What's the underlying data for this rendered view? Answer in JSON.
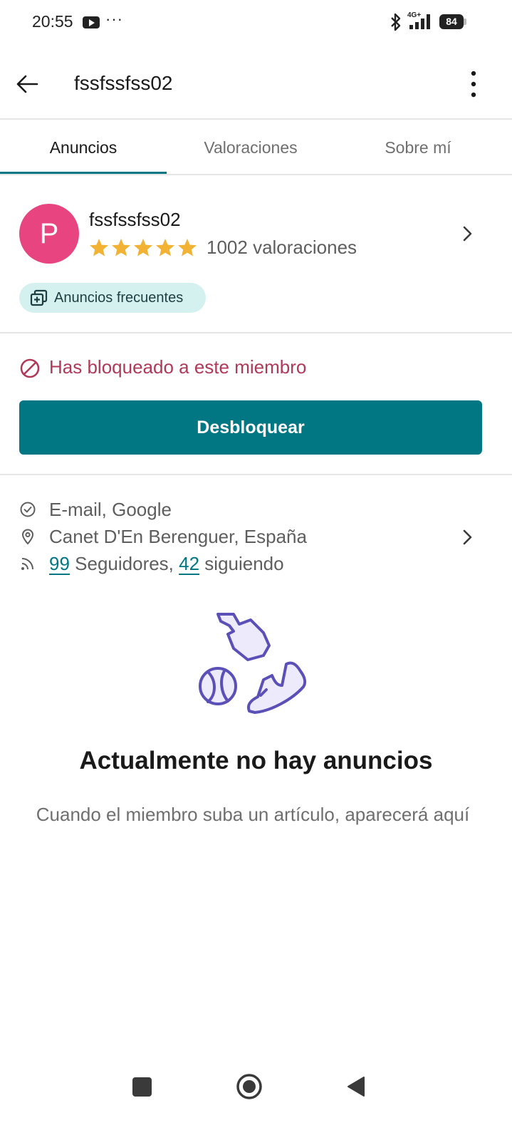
{
  "status_bar": {
    "time": "20:55",
    "more": "···",
    "network": "4G+",
    "battery": "84",
    "icons": [
      "youtube-icon",
      "bluetooth-icon",
      "signal-icon",
      "battery-icon"
    ]
  },
  "app_bar": {
    "title": "fssfssfss02",
    "back_icon": "arrow-left-icon",
    "menu_icon": "more-vertical-icon"
  },
  "tabs": [
    {
      "label": "Anuncios",
      "active": true
    },
    {
      "label": "Valoraciones",
      "active": false
    },
    {
      "label": "Sobre mí",
      "active": false
    }
  ],
  "profile": {
    "avatar_letter": "P",
    "avatar_color": "#e8447f",
    "name": "fssfssfss02",
    "rating_stars": 5,
    "reviews": "1002 valoraciones",
    "badge": "Anuncios frecuentes"
  },
  "blocked": {
    "message": "Has bloqueado a este miembro",
    "button": "Desbloquear"
  },
  "info": {
    "verification": "E-mail, Google",
    "location": "Canet D'En Berenguer, España",
    "followers_count": "99",
    "followers_label": " Seguidores, ",
    "following_count": "42",
    "following_label": " siguiendo"
  },
  "empty_state": {
    "title": "Actualmente no hay anuncios",
    "subtitle": "Cuando el miembro suba un artículo, aparecerá aquí"
  },
  "colors": {
    "accent": "#007782",
    "danger": "#b0395a",
    "star": "#f2b234",
    "badge_bg": "#d4f1ef",
    "illustration": "#5b4fb8"
  }
}
